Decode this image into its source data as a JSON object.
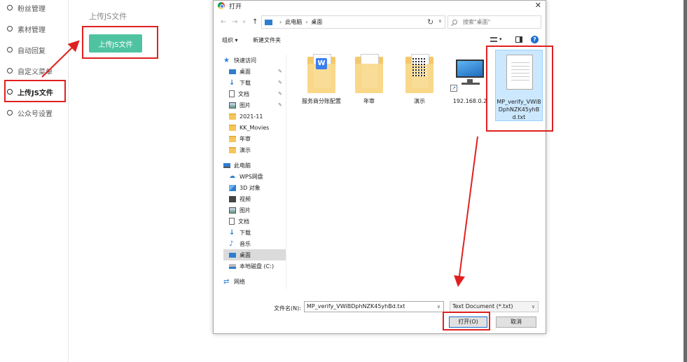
{
  "sidebar": {
    "items": [
      {
        "label": "粉丝管理"
      },
      {
        "label": "素材管理"
      },
      {
        "label": "自动回复"
      },
      {
        "label": "自定义菜单"
      },
      {
        "label": "上传JS文件"
      },
      {
        "label": "公众号设置"
      }
    ]
  },
  "main": {
    "section_title": "上传JS文件",
    "upload_button": "上传JS文件"
  },
  "dialog": {
    "title": "打开",
    "close": "✕",
    "address": {
      "pc": "此电脑",
      "folder": "桌面"
    },
    "search_placeholder": "搜索\"桌面\"",
    "toolbar": {
      "organize": "组织 ▾",
      "new_folder": "新建文件夹"
    },
    "nav": {
      "quick_access": "快速访问",
      "desktop": "桌面",
      "downloads": "下载",
      "documents": "文档",
      "pictures": "图片",
      "f2021": "2021-11",
      "kk": "KK_Movies",
      "nianshen": "年审",
      "yanshi": "演示",
      "this_pc": "此电脑",
      "wps": "WPS网盘",
      "obj3d": "3D 对象",
      "videos": "视频",
      "pc_pictures": "图片",
      "pc_documents": "文档",
      "pc_downloads": "下载",
      "music": "音乐",
      "pc_desktop": "桌面",
      "local_disk": "本地磁盘 (C:)",
      "network": "网络"
    },
    "files": [
      {
        "name": "服务商分账配置"
      },
      {
        "name": "年审"
      },
      {
        "name": "演示"
      },
      {
        "name": "192.168.0.2"
      },
      {
        "name": "MP_verify_VWiBDphNZK45yhBd.txt"
      }
    ],
    "filename_label": "文件名(N):",
    "filename_value": "MP_verify_VWiBDphNZK45yhBd.txt",
    "filetype": "Text Document (*.txt)",
    "open_button": "打开(O)",
    "cancel_button": "取消"
  },
  "colors": {
    "accent": "#4fc3a1",
    "highlight": "#e02020",
    "selection": "#cce8ff"
  }
}
